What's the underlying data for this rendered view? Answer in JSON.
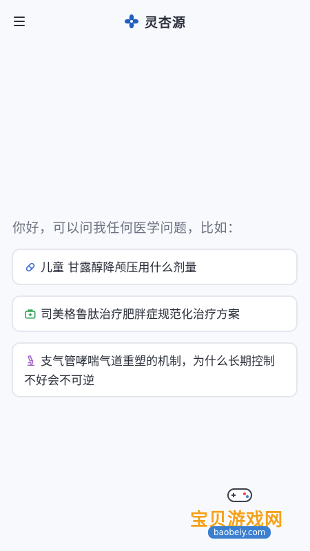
{
  "header": {
    "menu_icon": "hamburger-menu-icon",
    "logo_icon": "flower-logo-icon",
    "brand_color": "#1f5fbf",
    "title": "灵杏源"
  },
  "main": {
    "greeting": "你好，可以问我任何医学问题，比如：",
    "suggestions": [
      {
        "icon": "pill-icon",
        "icon_color": "#3b6fd6",
        "text": "儿童 甘露醇降颅压用什么剂量"
      },
      {
        "icon": "medical-kit-icon",
        "icon_color": "#2e9e55",
        "text": "司美格鲁肽治疗肥胖症规范化治疗方案"
      },
      {
        "icon": "microscope-icon",
        "icon_color": "#9b5cc7",
        "text": "支气管哮喘气道重塑的机制，为什么长期控制不好会不可逆"
      }
    ]
  },
  "watermark": {
    "title": "宝贝游戏网",
    "url": "baobeiy.com",
    "icon": "gamepad-icon"
  }
}
